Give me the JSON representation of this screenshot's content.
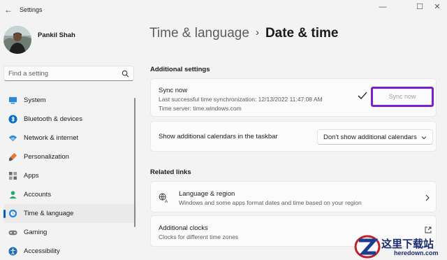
{
  "window": {
    "title": "Settings",
    "back_glyph": "←",
    "min_glyph": "—",
    "max_glyph": "☐",
    "close_glyph": "✕"
  },
  "profile": {
    "name": "Pankil Shah"
  },
  "search": {
    "placeholder": "Find a setting",
    "value": ""
  },
  "nav": {
    "items": [
      {
        "label": "System",
        "icon": "monitor-icon",
        "active": false
      },
      {
        "label": "Bluetooth & devices",
        "icon": "bluetooth-icon",
        "active": false
      },
      {
        "label": "Network & internet",
        "icon": "wifi-icon",
        "active": false
      },
      {
        "label": "Personalization",
        "icon": "brush-icon",
        "active": false
      },
      {
        "label": "Apps",
        "icon": "apps-icon",
        "active": false
      },
      {
        "label": "Accounts",
        "icon": "person-icon",
        "active": false
      },
      {
        "label": "Time & language",
        "icon": "globe-clock-icon",
        "active": true
      },
      {
        "label": "Gaming",
        "icon": "gamepad-icon",
        "active": false
      },
      {
        "label": "Accessibility",
        "icon": "accessibility-icon",
        "active": false
      }
    ]
  },
  "breadcrumb": {
    "parent": "Time & language",
    "separator": "›",
    "current": "Date & time"
  },
  "additional_settings": {
    "heading": "Additional settings",
    "sync": {
      "title": "Sync now",
      "last_sync": "Last successful time synchronization: 12/13/2022 11:47:08 AM",
      "time_server": "Time server: time.windows.com",
      "button_label": "Sync now",
      "highlight_color": "#7a1fc9"
    },
    "calendars": {
      "label": "Show additional calendars in the taskbar",
      "selected": "Don't show additional calendars"
    }
  },
  "related_links": {
    "heading": "Related links",
    "items": [
      {
        "title": "Language & region",
        "subtitle": "Windows and some apps format dates and time based on your region",
        "icon": "language-icon"
      },
      {
        "title": "Additional clocks",
        "subtitle": "Clocks for different time zones",
        "icon": "external-link-icon"
      }
    ]
  },
  "watermark": {
    "chinese_text": "这里下载站",
    "domain": "heredown.com"
  },
  "colors": {
    "accent": "#005fb8",
    "background": "#f3f3f3",
    "card": "#fbfbfb",
    "highlight_box": "#7a1fc9"
  }
}
